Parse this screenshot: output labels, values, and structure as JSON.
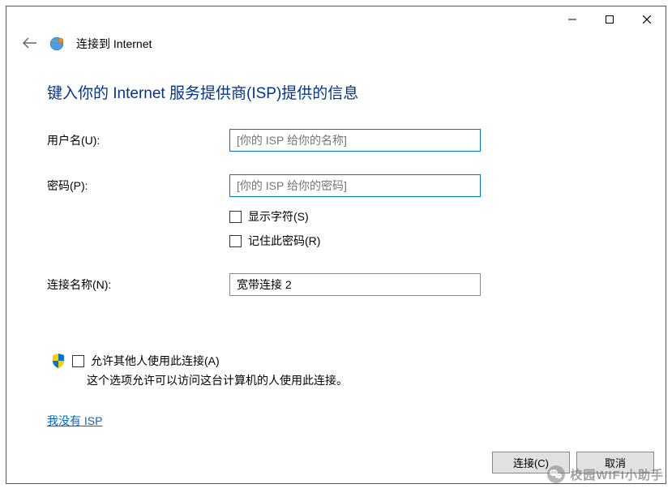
{
  "window_title": "连接到 Internet",
  "heading": "键入你的 Internet 服务提供商(ISP)提供的信息",
  "fields": {
    "username_label": "用户名(U):",
    "username_placeholder": "[你的 ISP 给你的名称]",
    "password_label": "密码(P):",
    "password_placeholder": "[你的 ISP 给你的密码]",
    "show_chars_label": "显示字符(S)",
    "remember_password_label": "记住此密码(R)",
    "connection_name_label": "连接名称(N):",
    "connection_name_value": "宽带连接 2"
  },
  "share": {
    "allow_label": "允许其他人使用此连接(A)",
    "description": "这个选项允许可以访问这台计算机的人使用此连接。"
  },
  "no_isp_link": "我没有 ISP",
  "buttons": {
    "connect": "连接(C)",
    "cancel": "取消"
  },
  "watermark": "校园WIFI小助手"
}
